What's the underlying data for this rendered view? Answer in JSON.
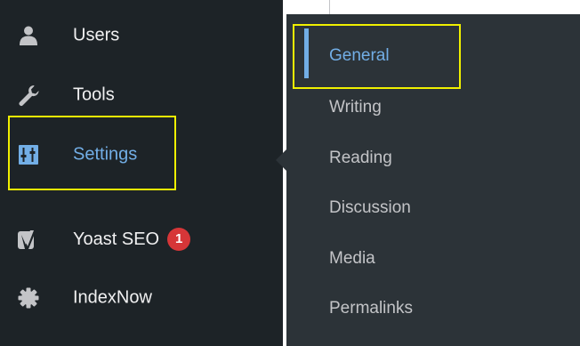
{
  "menu": {
    "items": [
      {
        "label": "Users",
        "icon": "users-icon"
      },
      {
        "label": "Tools",
        "icon": "wrench-icon"
      },
      {
        "label": "Settings",
        "icon": "settings-sliders-icon",
        "current": true
      },
      {
        "label": "Yoast SEO",
        "icon": "yoast-icon",
        "badge": "1"
      },
      {
        "label": "IndexNow",
        "icon": "gear-icon"
      }
    ]
  },
  "submenu": {
    "items": [
      {
        "label": "General",
        "current": true
      },
      {
        "label": "Writing"
      },
      {
        "label": "Reading"
      },
      {
        "label": "Discussion"
      },
      {
        "label": "Media"
      },
      {
        "label": "Permalinks"
      }
    ]
  },
  "colors": {
    "menu_background": "#1d2327",
    "submenu_background": "#2c3338",
    "text": "#f0f0f1",
    "submenu_text": "#c3c4c7",
    "active": "#72aee6",
    "badge": "#d63638",
    "highlight": "#f0f000"
  }
}
